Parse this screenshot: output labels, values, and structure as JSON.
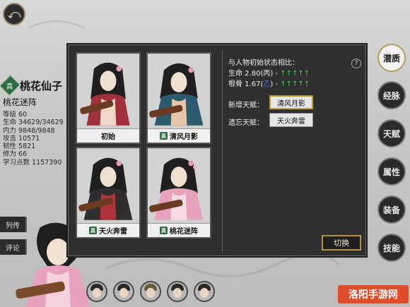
{
  "header": {
    "back_icon": "back-arrow-icon"
  },
  "character": {
    "badge": "真",
    "name": "桃花仙子",
    "title": "桃花迷阵",
    "stats": [
      "等级 60",
      "生命 34629/34629",
      "内力 9848/9848",
      "攻击 10571",
      "韧性 5821",
      "修为 66",
      "学习点数 1157390"
    ]
  },
  "side_tabs": [
    "列传",
    "评论"
  ],
  "cards": [
    {
      "label": "初始",
      "badge": ""
    },
    {
      "label": "清风月影",
      "badge": "真"
    },
    {
      "label": "天火奔雷",
      "badge": "真"
    },
    {
      "label": "桃花迷阵",
      "badge": "真"
    }
  ],
  "info": {
    "compare_title": "与人物初始状态相比：",
    "life_text": "生命 2.80(丙) -",
    "life_up": "↑↑↑↑↑",
    "bone_text": "根骨 1.67(",
    "bone_grade": "乙",
    "bone_tail": ") -",
    "bone_up": "↑↑↑↑↑",
    "help_icon": "?"
  },
  "talents": {
    "new_label": "新增天赋：",
    "new_value": "清风月影",
    "lost_label": "遗忘天赋：",
    "lost_value": "天火奔雷"
  },
  "switch_label": "切换",
  "right_tabs": [
    "潜质",
    "经脉",
    "天赋",
    "属性",
    "装备",
    "技能"
  ],
  "watermark": "洛阳手游网",
  "colors": {
    "accent_gold": "#c79a2c",
    "badge_green": "#2f6a44",
    "up_green": "#3bd24a"
  }
}
